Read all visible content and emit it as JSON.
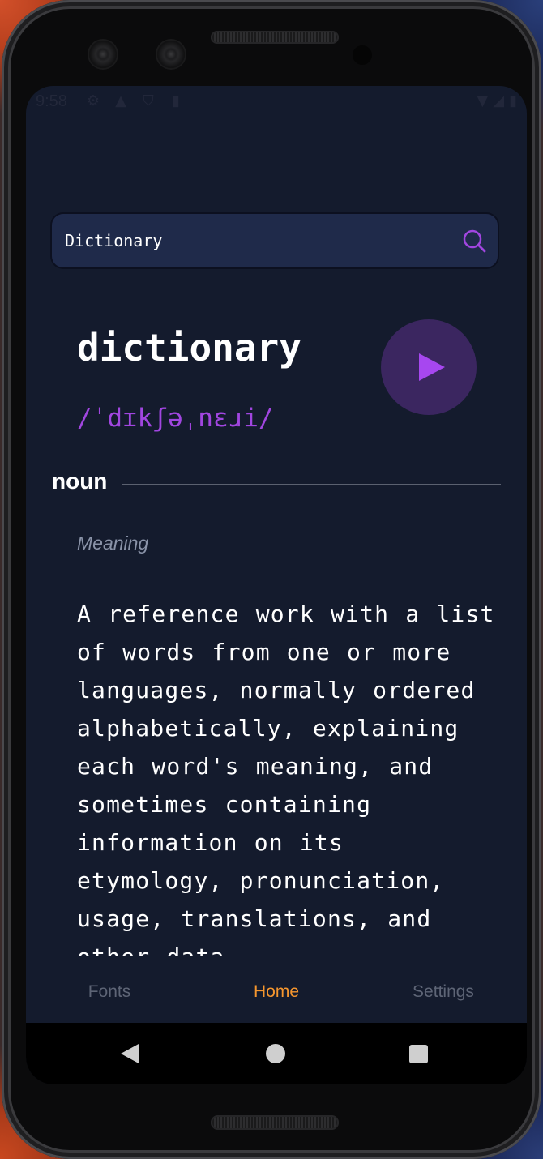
{
  "status_bar": {
    "time": "9:58"
  },
  "search": {
    "value": "Dictionary",
    "icon": "search-icon"
  },
  "entry": {
    "word": "dictionary",
    "phonetic": "/ˈdɪkʃəˌnɛɹi/",
    "part_of_speech": "noun",
    "meaning_label": "Meaning",
    "definition": "A reference work with a list of words from one or more languages, normally ordered alphabetically, explaining each word's meaning, and sometimes containing information on its etymology, pronunciation, usage, translations, and other data."
  },
  "bottom_nav": {
    "items": [
      {
        "label": "Fonts",
        "active": false
      },
      {
        "label": "Home",
        "active": true
      },
      {
        "label": "Settings",
        "active": false
      }
    ]
  },
  "colors": {
    "background": "#141b2d",
    "search_bg": "#1f2a4a",
    "accent_purple": "#a146e0",
    "play_bg": "#3b2660",
    "nav_active": "#f5962e",
    "nav_inactive": "#5e6576"
  }
}
